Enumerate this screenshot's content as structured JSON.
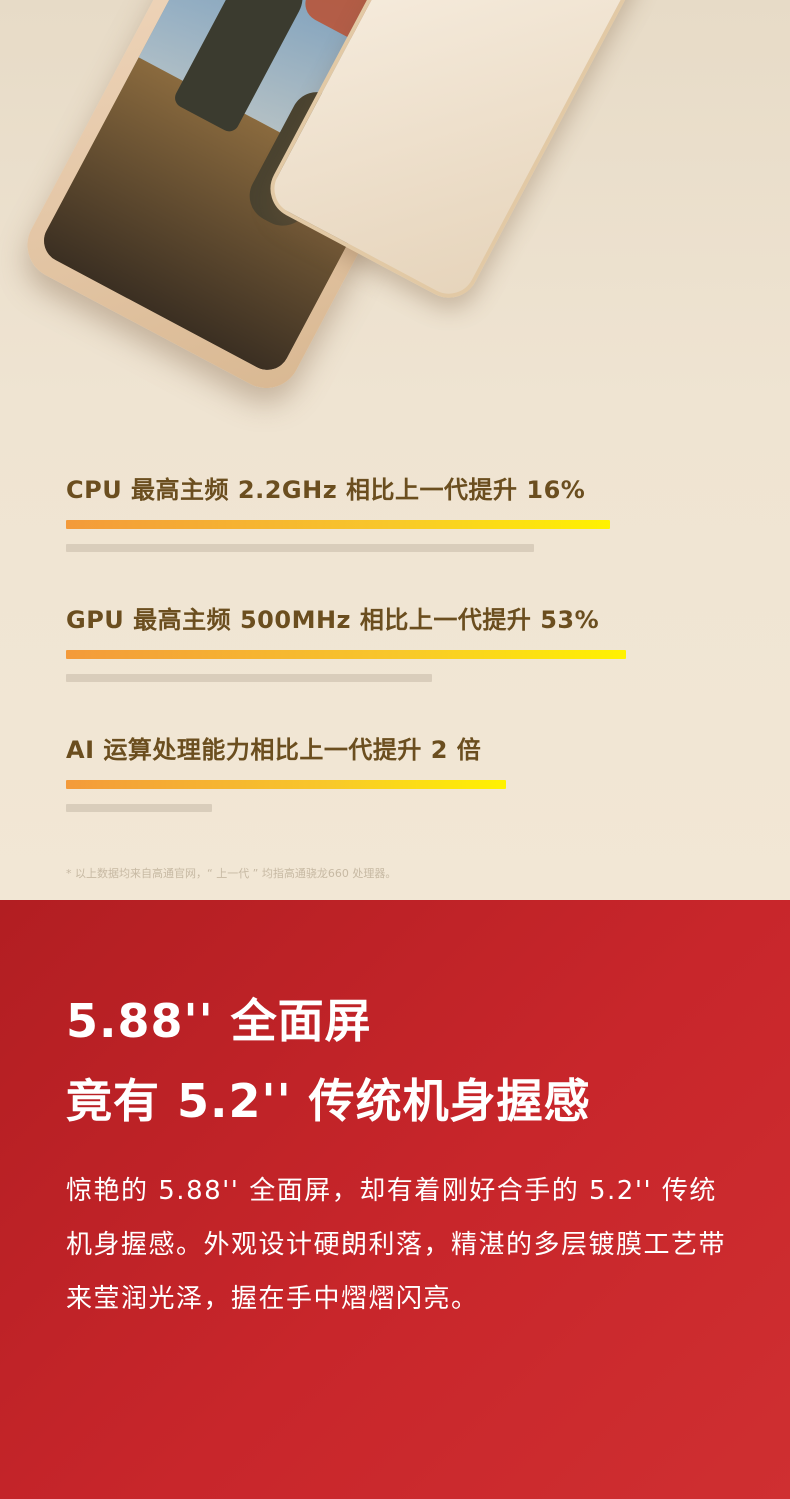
{
  "stats": [
    {
      "label": "CPU 最高主频 2.2GHz 相比上一代提升 16%",
      "value_percent": 16
    },
    {
      "label": "GPU 最高主频 500MHz 相比上一代提升 53%",
      "value_percent": 53
    },
    {
      "label": "AI 运算处理能力相比上一代提升 2 倍",
      "value_multiplier": 2
    }
  ],
  "footnote": "* 以上数据均来自高通官网，“ 上一代 ” 均指高通骁龙660 处理器。",
  "headline": {
    "line1": "5.88'' 全面屏",
    "line2": "竟有 5.2'' 传统机身握感"
  },
  "description": "惊艳的 5.88'' 全面屏，却有着刚好合手的 5.2'' 传统机身握感。外观设计硬朗利落，精湛的多层镀膜工艺带来莹润光泽，握在手中熠熠闪亮。",
  "colors": {
    "accent_red": "#c8262b",
    "bar_orange": "#f39a3a",
    "bar_yellow": "#fff200",
    "label_brown": "#6b4e1f"
  }
}
